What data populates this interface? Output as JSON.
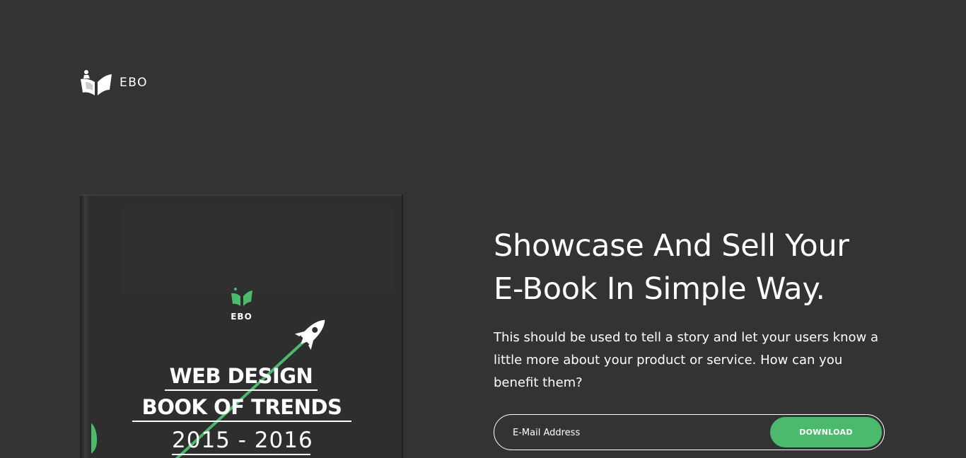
{
  "brand": {
    "name": "EBO",
    "logo_icon": "open-book-logo-icon",
    "accent_color": "#4cba6c"
  },
  "hero": {
    "title_line1": "Showcase And Sell Your",
    "title_line2": "E-Book In Simple Way.",
    "description": "This should be used to tell a story and let your users know a little more about your product or service. How can you benefit them?"
  },
  "form": {
    "email_placeholder": "E-Mail Address",
    "email_value": "",
    "button_label": "DOWNLOAD"
  },
  "book_cover": {
    "brand": "EBO",
    "title_line1": "WEB DESIGN",
    "title_line2": "BOOK OF TRENDS",
    "years": "2015 - 2016",
    "illustration_icon": "rocket-icon"
  }
}
